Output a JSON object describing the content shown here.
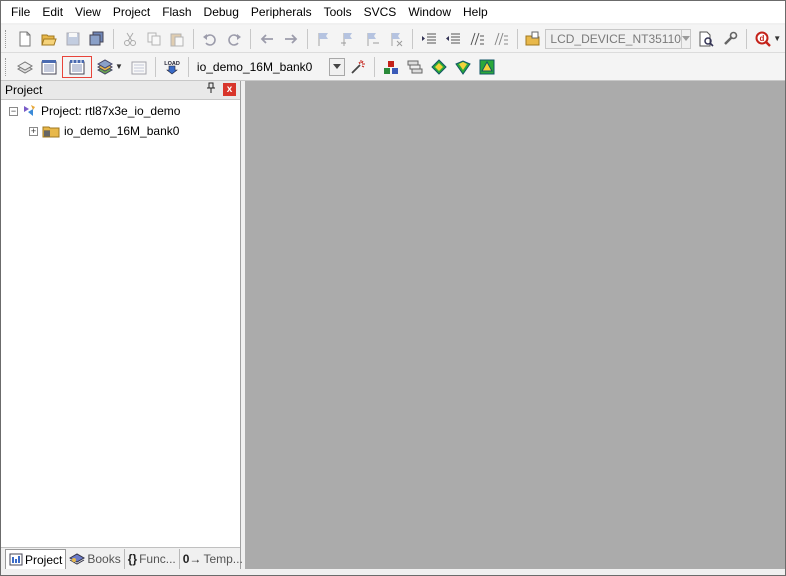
{
  "menu": [
    "File",
    "Edit",
    "View",
    "Project",
    "Flash",
    "Debug",
    "Peripherals",
    "Tools",
    "SVCS",
    "Window",
    "Help"
  ],
  "toolbar1": {
    "device_combo": "LCD_DEVICE_NT35110"
  },
  "toolbar2": {
    "target_combo": "io_demo_16M_bank0",
    "load_label": "LOAD"
  },
  "project_panel": {
    "title": "Project",
    "pin": "↑",
    "close": "x",
    "root_label": "Project: rtl87x3e_io_demo",
    "target_label": "io_demo_16M_bank0"
  },
  "tabs": [
    {
      "label": "Project",
      "icon": "project-icon"
    },
    {
      "label": "Books",
      "icon": "books-icon"
    },
    {
      "label": "Func...",
      "icon": "functions-icon",
      "glyph": "{}"
    },
    {
      "label": "Temp...",
      "icon": "templates-icon",
      "glyph": "0→"
    }
  ],
  "colors": {
    "editor_bg": "#ababab",
    "highlight_border": "#e8443a",
    "close_red": "#d8352b"
  }
}
